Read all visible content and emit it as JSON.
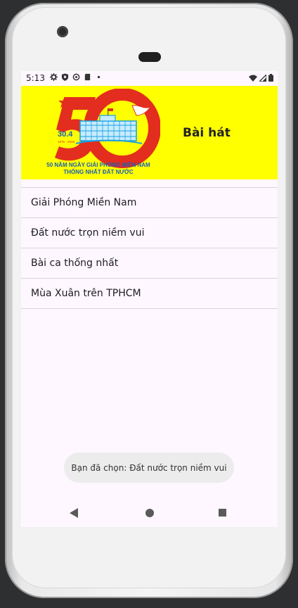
{
  "status_bar": {
    "time": "5:13"
  },
  "header": {
    "title": "Bài hát",
    "logo": {
      "big_number": "50",
      "date": "30.4",
      "years": "1975 - 2025",
      "caption_line1": "50 NĂM NGÀY GIẢI PHÓNG MIỀN NAM",
      "caption_line2": "THỐNG NHẤT ĐẤT NƯỚC"
    }
  },
  "songs": [
    {
      "title": "Giải Phóng Miền Nam"
    },
    {
      "title": "Đất nước trọn niềm vui"
    },
    {
      "title": "Bài ca thống nhất"
    },
    {
      "title": "Mùa Xuân trên TPHCM"
    }
  ],
  "toast": {
    "message": "Bạn đã chọn: Đất nước trọn niềm vui"
  },
  "colors": {
    "header_bg": "#ffff00",
    "logo_red": "#e32d1f",
    "logo_blue": "#1aa0e0"
  }
}
